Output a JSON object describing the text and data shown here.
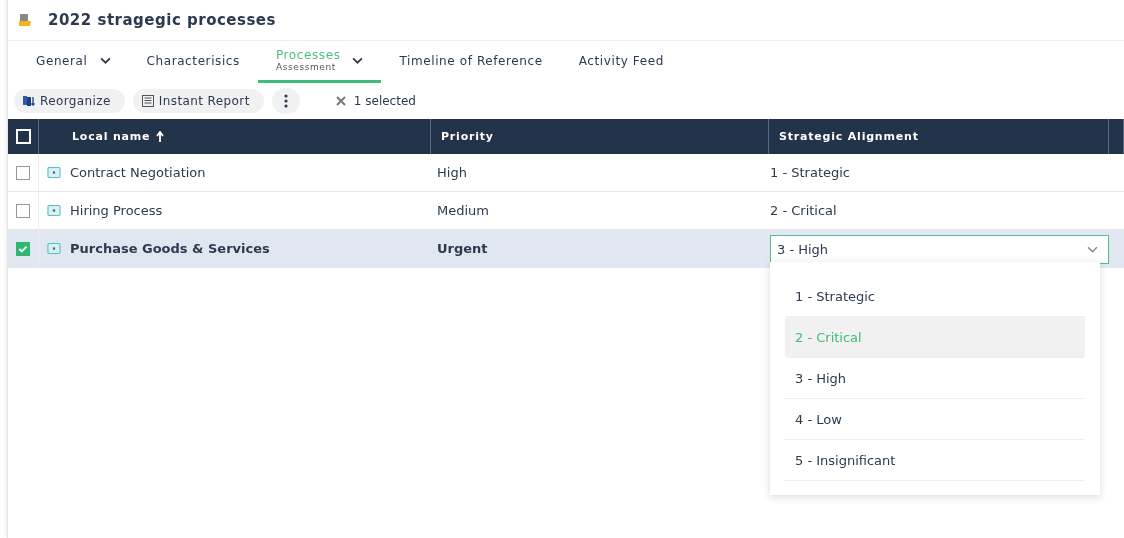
{
  "title": "2022 stragegic processes",
  "tabs": [
    {
      "label": "General",
      "dropdown": true,
      "selected": false
    },
    {
      "label": "Characterisics",
      "dropdown": false,
      "selected": false
    },
    {
      "label": "Processes",
      "sub": "Assessment",
      "dropdown": true,
      "selected": true
    },
    {
      "label": "Timeline of Reference",
      "dropdown": false,
      "selected": false
    },
    {
      "label": "Activity Feed",
      "dropdown": false,
      "selected": false
    }
  ],
  "toolbar": {
    "buttons": [
      {
        "label": "Reorganize",
        "kind": "reorganize"
      },
      {
        "label": "Instant Report",
        "kind": "report"
      }
    ],
    "selection": "1 selected"
  },
  "table": {
    "columns": [
      "Local name",
      "Priority",
      "Strategic Alignment"
    ],
    "all_checked": false,
    "rows": [
      {
        "name": "Contract Negotiation",
        "priority": "High",
        "alignment": "1 - Strategic",
        "selected": false,
        "editing": false
      },
      {
        "name": "Hiring Process",
        "priority": "Medium",
        "alignment": "2 - Critical",
        "selected": false,
        "editing": false
      },
      {
        "name": "Purchase Goods & Services",
        "priority": "Urgent",
        "alignment": "3 - High",
        "selected": true,
        "editing": true
      }
    ]
  },
  "dropdown": {
    "options": [
      {
        "label": "1 - Strategic",
        "highlighted": false
      },
      {
        "label": "2 - Critical",
        "highlighted": true
      },
      {
        "label": "3 - High",
        "highlighted": false
      },
      {
        "label": "4 - Low",
        "highlighted": false
      },
      {
        "label": "5 - Insignificant",
        "highlighted": false
      }
    ]
  }
}
